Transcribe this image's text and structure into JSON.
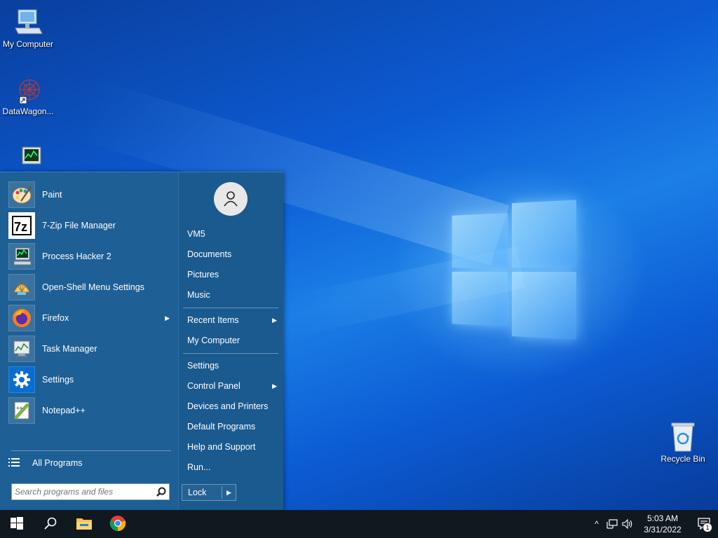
{
  "desktop": {
    "icons": [
      {
        "label": "My Computer",
        "icon": "computer-icon"
      },
      {
        "label": "DataWagon...",
        "icon": "datawagon-icon"
      },
      {
        "label": "",
        "icon": "process-hacker-icon"
      },
      {
        "label": "Recycle Bin",
        "icon": "recycle-bin-icon"
      }
    ]
  },
  "start_menu": {
    "programs": [
      {
        "label": "Paint",
        "icon": "paint-icon",
        "submenu": false
      },
      {
        "label": "7-Zip File Manager",
        "icon": "7zip-icon",
        "submenu": false
      },
      {
        "label": "Process Hacker 2",
        "icon": "process-hacker-icon",
        "submenu": false
      },
      {
        "label": "Open-Shell Menu Settings",
        "icon": "open-shell-icon",
        "submenu": false
      },
      {
        "label": "Firefox",
        "icon": "firefox-icon",
        "submenu": true
      },
      {
        "label": "Task Manager",
        "icon": "task-manager-icon",
        "submenu": false
      },
      {
        "label": "Settings",
        "icon": "gear-icon",
        "submenu": false
      },
      {
        "label": "Notepad++",
        "icon": "notepad-plus-plus-icon",
        "submenu": false
      }
    ],
    "all_programs_label": "All Programs",
    "search_placeholder": "Search programs and files",
    "right_items": [
      {
        "label": "VM5",
        "submenu": false
      },
      {
        "label": "Documents",
        "submenu": false
      },
      {
        "label": "Pictures",
        "submenu": false
      },
      {
        "label": "Music",
        "submenu": false
      },
      {
        "label": "Recent Items",
        "submenu": true
      },
      {
        "label": "My Computer",
        "submenu": false
      },
      {
        "label": "Settings",
        "submenu": false
      },
      {
        "label": "Control Panel",
        "submenu": true
      },
      {
        "label": "Devices and Printers",
        "submenu": false
      },
      {
        "label": "Default Programs",
        "submenu": false
      },
      {
        "label": "Help and Support",
        "submenu": false
      },
      {
        "label": "Run...",
        "submenu": false
      }
    ],
    "lock_label": "Lock",
    "submenu_arrow": "▶"
  },
  "taskbar": {
    "pinned": [
      "start-icon",
      "search-icon",
      "file-explorer-icon",
      "chrome-icon"
    ],
    "tray_chevron": "^",
    "clock_time": "5:03 AM",
    "clock_date": "3/31/2022",
    "notification_count": "1"
  },
  "colors": {
    "start_menu_bg": "#1e5f95",
    "taskbar_bg": "#101820",
    "wallpaper_blue": "#0c5bd3"
  }
}
